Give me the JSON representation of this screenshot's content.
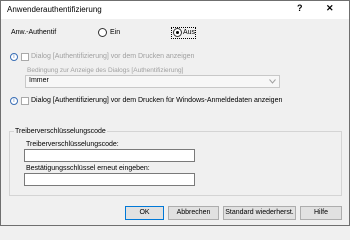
{
  "window": {
    "title": "Anwenderauthentifizierung",
    "help_glyph": "?",
    "close_glyph": "✕"
  },
  "auth": {
    "label": "Anw.-Authentif",
    "option_on": "Ein",
    "option_off": "Aus",
    "selected": "Aus"
  },
  "dialog_print": {
    "label": "Dialog [Authentifizierung] vor dem Drucken anzeigen",
    "checked": false
  },
  "condition": {
    "label": "Bedingung zur Anzeige des Dialogs [Authentifizierung]",
    "value": "Immer"
  },
  "dialog_windows": {
    "label": "Dialog [Authentifizierung] vor dem Drucken für Windows-Anmeldedaten anzeigen",
    "checked": false
  },
  "group": {
    "title": "Treiberverschlüsselungscode",
    "code_label": "Treiberverschlüsselungscode:",
    "code_value": "",
    "confirm_label": "Bestätigungsschlüssel erneut eingeben:",
    "confirm_value": ""
  },
  "buttons": {
    "ok": "OK",
    "cancel": "Abbrechen",
    "defaults": "Standard wiederherst.",
    "help": "Hilfe"
  },
  "colors": {
    "accent": "#0078d7",
    "info": "#3b6fb6"
  }
}
